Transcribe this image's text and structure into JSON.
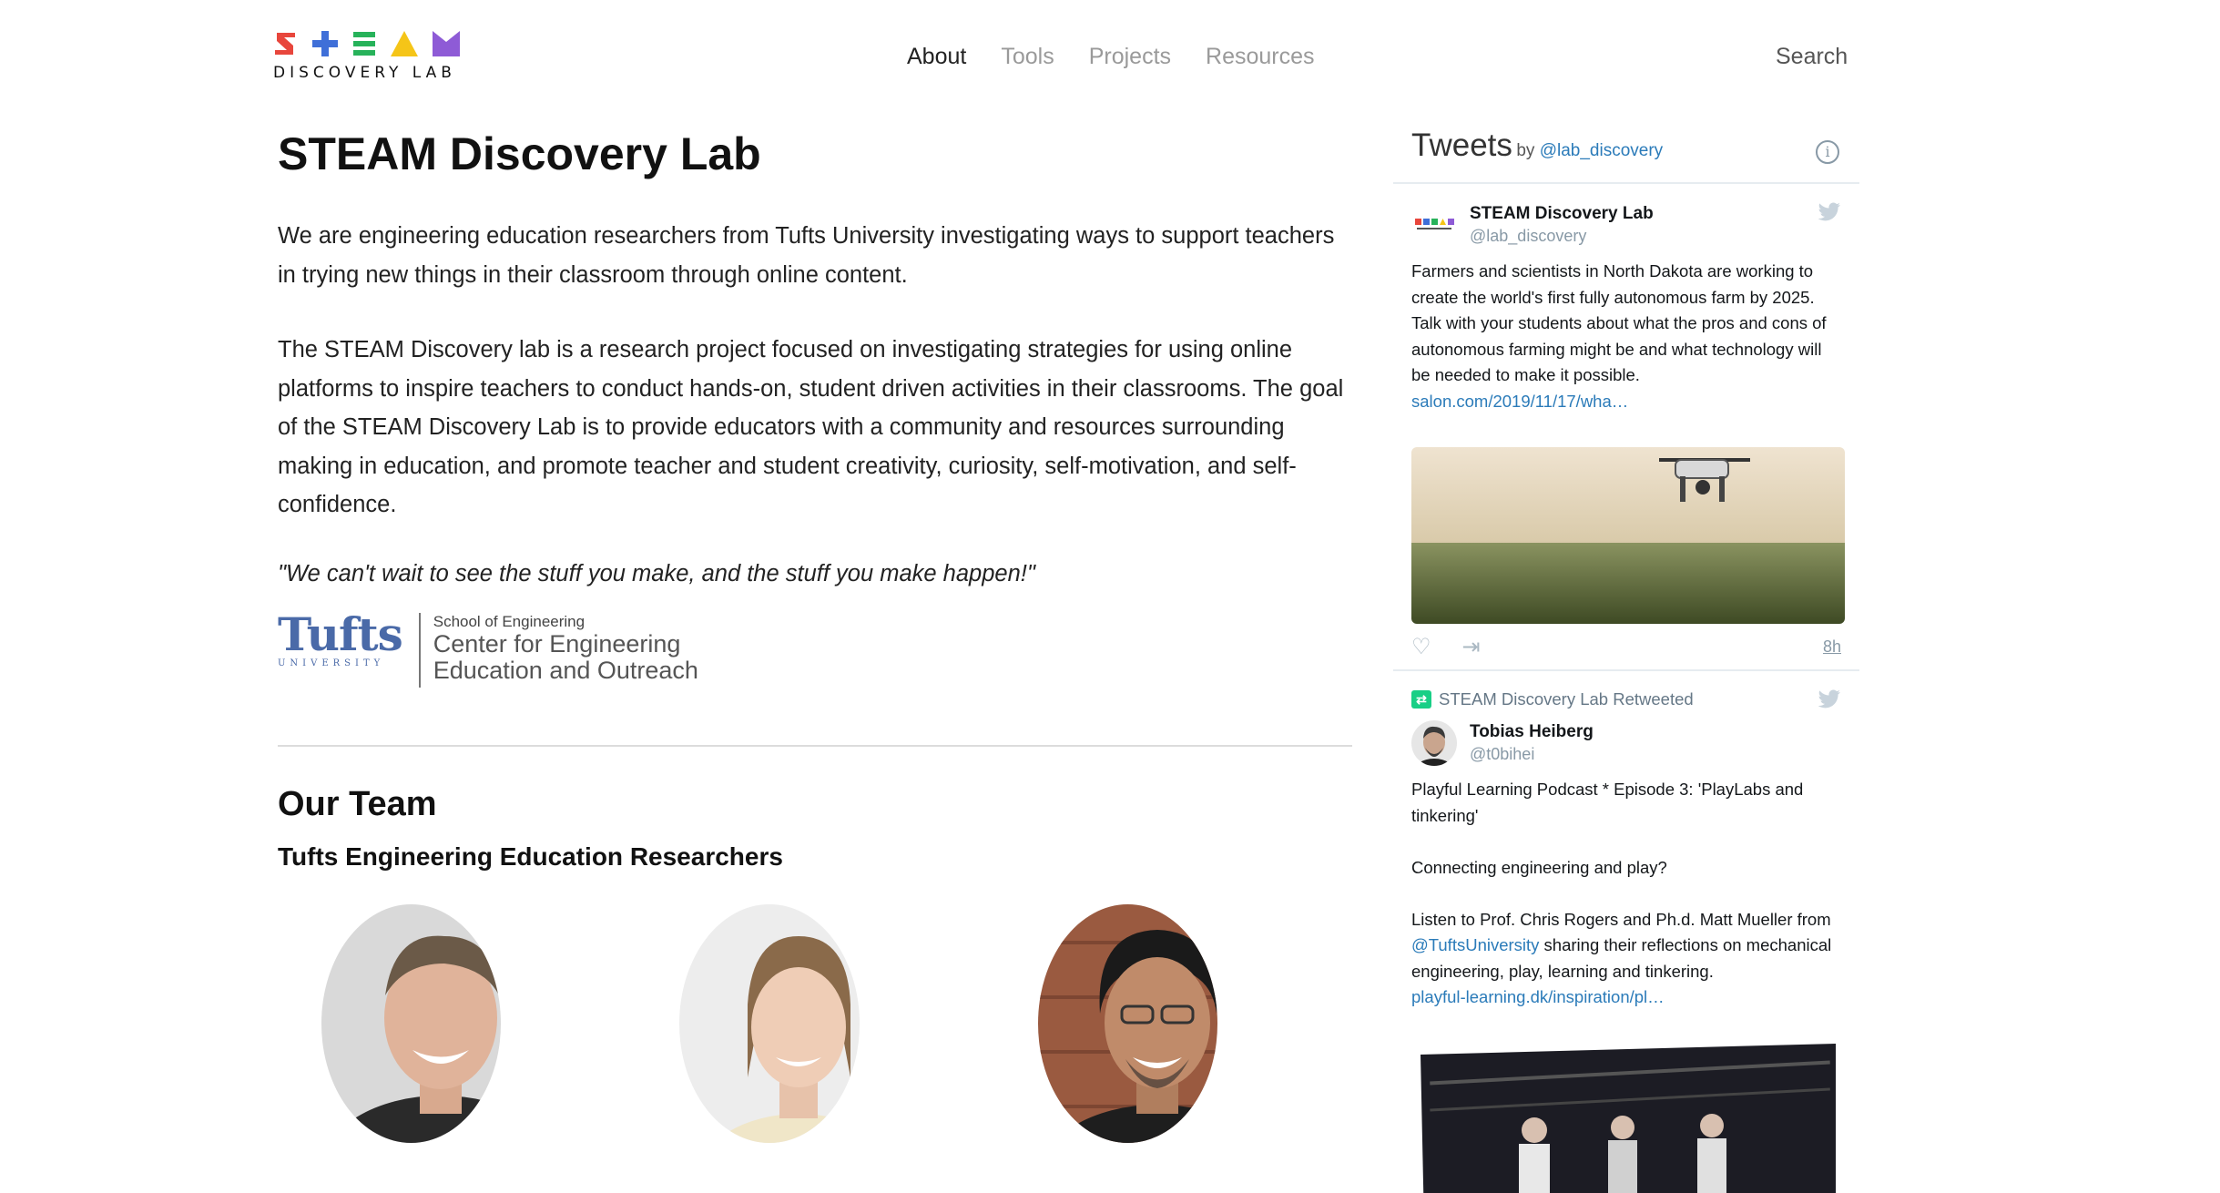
{
  "brand": {
    "wordmark": "DISCOVERY LAB",
    "letters": [
      "S",
      "T",
      "E",
      "A",
      "M"
    ],
    "colors": {
      "s": "#e8463c",
      "t": "#3f6fd8",
      "e": "#27b25a",
      "a": "#f5c518",
      "m": "#8e5bd6"
    }
  },
  "nav": {
    "items": [
      "About",
      "Tools",
      "Projects",
      "Resources"
    ],
    "active": "About",
    "search": "Search"
  },
  "main": {
    "title": "STEAM Discovery Lab",
    "paragraphs": [
      "We are engineering education researchers from Tufts University investigating ways to support teachers in trying new things in their classroom through online content.",
      "The STEAM Discovery lab is a research project focused on investigating strategies for using online platforms to inspire teachers to conduct hands-on, student driven activities in their classrooms. The goal of the STEAM Discovery Lab is to provide educators with a community and resources surrounding making in education, and promote teacher and student creativity, curiosity, self-motivation, and self-confidence."
    ],
    "quote": "\"We can't wait to see the stuff you make, and the stuff you make happen!\"",
    "partner_logo": {
      "name": "Tufts",
      "sub": "UNIVERSITY",
      "school": "School of Engineering",
      "center_line1": "Center for Engineering",
      "center_line2": "Education and Outreach"
    },
    "team_title": "Our Team",
    "team_subtitle": "Tufts Engineering Education Researchers"
  },
  "tweets": {
    "title": "Tweets",
    "by": "by",
    "handle": "@lab_discovery",
    "items": [
      {
        "name": "STEAM Discovery Lab",
        "handle": "@lab_discovery",
        "text": "Farmers and scientists in North Dakota are working to create the world's first fully autonomous farm by 2025. Talk with your students about what the pros and cons of autonomous farming might be and what technology will be needed to make it possible.",
        "link": "salon.com/2019/11/17/wha…",
        "time": "8h"
      },
      {
        "retweeted_by": "STEAM Discovery Lab Retweeted",
        "name": "Tobias Heiberg",
        "handle": "@t0bihei",
        "text1": "Playful Learning Podcast * Episode 3: 'PlayLabs and tinkering'",
        "text2": "Connecting engineering and play?",
        "text3_a": "Listen to Prof. Chris Rogers and Ph.d. Matt Mueller from ",
        "text3_mention": "@TuftsUniversity",
        "text3_b": " sharing their reflections on mechanical engineering, play, learning and tinkering.",
        "link": "playful-learning.dk/inspiration/pl…"
      }
    ]
  }
}
